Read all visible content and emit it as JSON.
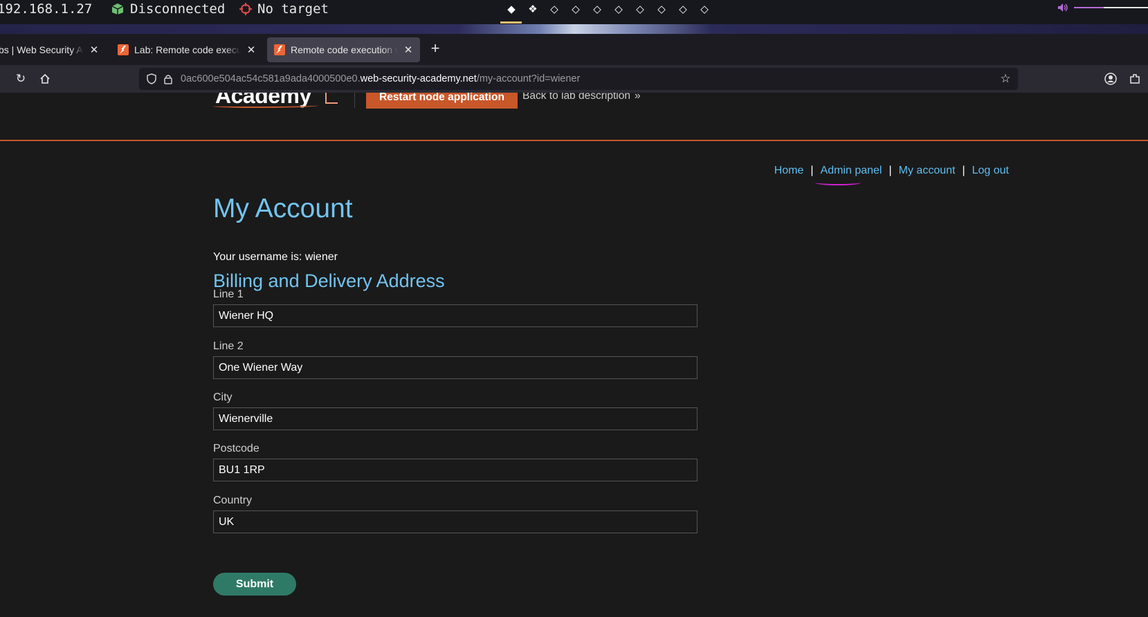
{
  "system_bar": {
    "ip": "192.168.1.27",
    "vpn_status": "Disconnected",
    "target": "No target",
    "workspaces": [
      "◆",
      "❖",
      "◇",
      "◇",
      "◇",
      "◇",
      "◇",
      "◇",
      "◇",
      "◇"
    ],
    "volume_level": 0.33
  },
  "tabs": [
    {
      "title": "bs | Web Security Aca",
      "active": false
    },
    {
      "title": "Lab: Remote code execution",
      "active": false
    },
    {
      "title": "Remote code execution via",
      "active": true
    }
  ],
  "new_tab_label": "+",
  "url": {
    "prefix": "0ac600e504ac54c581a9ada4000500e0.",
    "host": "web-security-academy.net",
    "path": "/my-account?id=wiener"
  },
  "lab_header": {
    "logo_text": "Academy",
    "restart_button": "Restart node application",
    "back_link": "Back to lab description",
    "back_chevron": "»"
  },
  "nav": {
    "home": "Home",
    "admin_panel": "Admin panel",
    "my_account": "My account",
    "log_out": "Log out",
    "separator": "|"
  },
  "page": {
    "title": "My Account",
    "username_line": "Your username is: wiener",
    "section_title": "Billing and Delivery Address"
  },
  "form": {
    "line1": {
      "label": "Line 1",
      "value": "Wiener HQ"
    },
    "line2": {
      "label": "Line 2",
      "value": "One Wiener Way"
    },
    "city": {
      "label": "City",
      "value": "Wienerville"
    },
    "postcode": {
      "label": "Postcode",
      "value": "BU1 1RP"
    },
    "country": {
      "label": "Country",
      "value": "UK"
    },
    "submit": "Submit"
  },
  "colors": {
    "accent_orange": "#c8572a",
    "link_blue": "#5fbdf0",
    "heading_blue": "#72c4f0",
    "submit_green": "#2f7a66"
  }
}
